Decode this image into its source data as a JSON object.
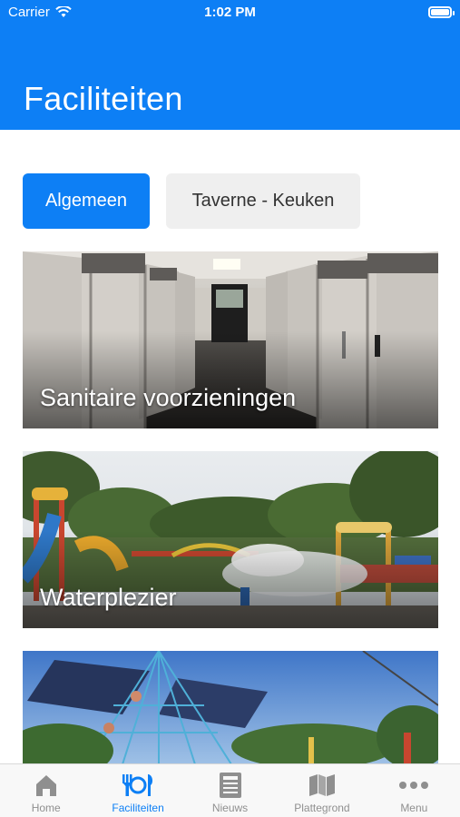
{
  "status_bar": {
    "carrier": "Carrier",
    "time": "1:02 PM"
  },
  "header": {
    "title": "Faciliteiten"
  },
  "segments": [
    {
      "label": "Algemeen",
      "active": true
    },
    {
      "label": "Taverne - Keuken",
      "active": false
    }
  ],
  "cards": [
    {
      "label": "Sanitaire voorzieningen"
    },
    {
      "label": "Waterplezier"
    },
    {
      "label": ""
    }
  ],
  "tabbar": [
    {
      "label": "Home",
      "icon": "home-icon",
      "active": false
    },
    {
      "label": "Faciliteiten",
      "icon": "cutlery-icon",
      "active": true
    },
    {
      "label": "Nieuws",
      "icon": "newspaper-icon",
      "active": false
    },
    {
      "label": "Plattegrond",
      "icon": "map-icon",
      "active": false
    },
    {
      "label": "Menu",
      "icon": "more-icon",
      "active": false
    }
  ],
  "colors": {
    "accent": "#0d7ff5",
    "inactive": "#8f8f8f"
  }
}
